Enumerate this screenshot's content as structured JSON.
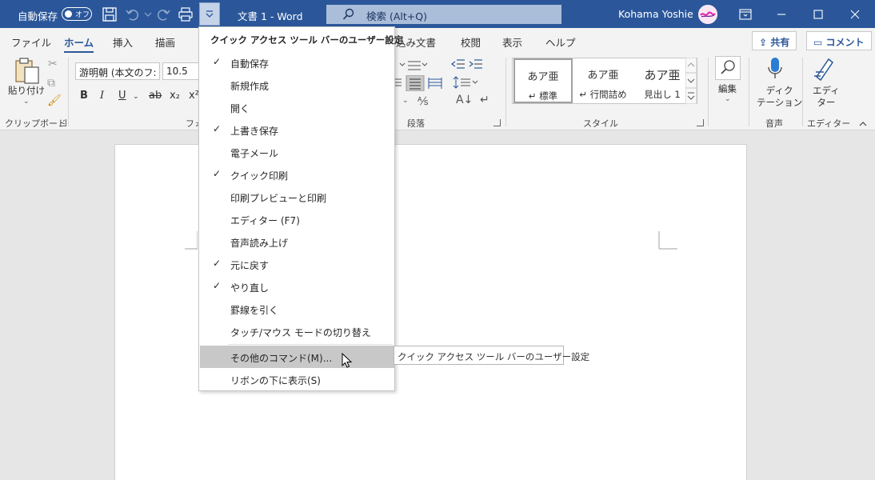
{
  "titlebar": {
    "autosave_label": "自動保存",
    "autosave_state": "オフ",
    "doc_title": "文書 1 - Word",
    "search_placeholder": "検索 (Alt+Q)",
    "user_name": "Kohama Yoshie",
    "accent": "#2b579a"
  },
  "tabs": [
    {
      "label": "ファイル"
    },
    {
      "label": "ホーム"
    },
    {
      "label": "挿入"
    },
    {
      "label": "描画"
    },
    {
      "label": "差し込み文書"
    },
    {
      "label": "校閲"
    },
    {
      "label": "表示"
    },
    {
      "label": "ヘルプ"
    }
  ],
  "actions": {
    "share": "共有",
    "comment": "コメント"
  },
  "ribbon": {
    "clipboard": {
      "paste": "貼り付け",
      "label": "クリップボード"
    },
    "font": {
      "name": "游明朝 (本文のフ:",
      "size": "10.5",
      "bold": "B",
      "italic": "I",
      "underline": "U",
      "strike": "ab",
      "sub": "x₂",
      "sup": "x²",
      "label": "フォ"
    },
    "paragraph": {
      "label": "段落"
    },
    "styles": {
      "items": [
        {
          "preview": "あア亜",
          "name": "↵ 標準"
        },
        {
          "preview": "あア亜",
          "name": "↵ 行間詰め"
        },
        {
          "preview": "あア亜",
          "name": "見出し 1"
        }
      ],
      "label": "スタイル"
    },
    "edit": {
      "label": "編集"
    },
    "voice": {
      "btn": [
        "ディク",
        "テーション"
      ],
      "label": "音声"
    },
    "editor": {
      "btn": [
        "エディ",
        "ター"
      ],
      "label": "エディター"
    }
  },
  "menu": {
    "header": "クイック アクセス ツール バーのユーザー設定",
    "items": [
      {
        "label": "自動保存",
        "checked": "✓"
      },
      {
        "label": "新規作成",
        "checked": ""
      },
      {
        "label": "開く",
        "checked": ""
      },
      {
        "label": "上書き保存",
        "checked": "✓"
      },
      {
        "label": "電子メール",
        "checked": ""
      },
      {
        "label": "クイック印刷",
        "checked": "✓"
      },
      {
        "label": "印刷プレビューと印刷",
        "checked": ""
      },
      {
        "label": "エディター (F7)",
        "checked": ""
      },
      {
        "label": "音声読み上げ",
        "checked": ""
      },
      {
        "label": "元に戻す",
        "checked": "✓"
      },
      {
        "label": "やり直し",
        "checked": "✓"
      },
      {
        "label": "罫線を引く",
        "checked": ""
      },
      {
        "label": "タッチ/マウス モードの切り替え",
        "checked": ""
      }
    ],
    "more_commands": "その他のコマンド(M)...",
    "show_below": "リボンの下に表示(S)"
  },
  "tooltip": "クイック アクセス ツール バーのユーザー設定"
}
